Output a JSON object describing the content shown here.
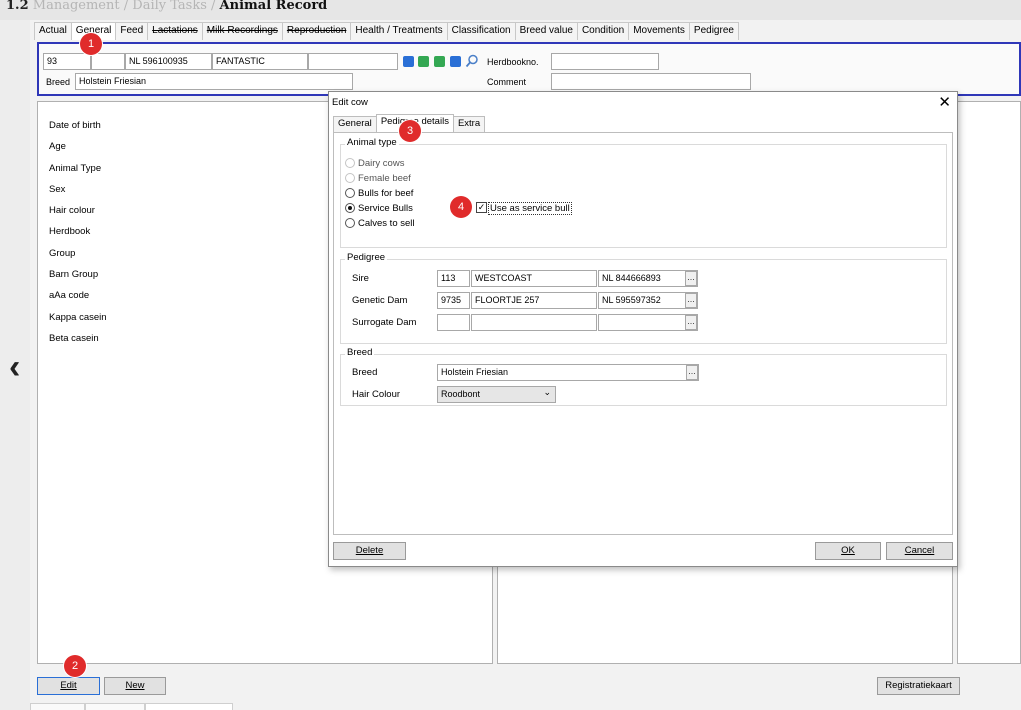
{
  "breadcrumb": {
    "number": "1.2",
    "path1": "Management",
    "sep": "/",
    "path2": "Daily Tasks",
    "current": "Animal Record"
  },
  "tabs": [
    {
      "label": "Actual",
      "strike": false
    },
    {
      "label": "General",
      "strike": false,
      "active": true
    },
    {
      "label": "Feed",
      "strike": false
    },
    {
      "label": "Lactations",
      "strike": true
    },
    {
      "label": "Milk Recordings",
      "strike": true
    },
    {
      "label": "Reproduction",
      "strike": true
    },
    {
      "label": "Health / Treatments",
      "strike": false
    },
    {
      "label": "Classification",
      "strike": false
    },
    {
      "label": "Breed value",
      "strike": false
    },
    {
      "label": "Condition",
      "strike": false
    },
    {
      "label": "Movements",
      "strike": false
    },
    {
      "label": "Pedigree",
      "strike": false
    }
  ],
  "header": {
    "animal_no": "93",
    "field2": "",
    "life_no": "NL 596100935",
    "name": "FANTASTIC",
    "field5": "",
    "herdbook_label": "Herdbookno.",
    "herdbook_value": "",
    "breed_label": "Breed",
    "breed_value": "Holstein Friesian",
    "comment_label": "Comment",
    "comment_value": ""
  },
  "nav_colors": {
    "first": "#2a6fd6",
    "prev": "#34a853",
    "next": "#34a853",
    "last": "#2a6fd6"
  },
  "left_fields": [
    "Date of birth",
    "Age",
    "Animal Type",
    "Sex",
    "Hair colour",
    "Herdbook",
    "Group",
    "Barn Group",
    "aAa code",
    "Kappa casein",
    "Beta casein"
  ],
  "badges": {
    "b1": "1",
    "b2": "2",
    "b3": "3",
    "b4": "4"
  },
  "bottom_buttons": {
    "edit": "Edit",
    "new": "New",
    "reg": "Registratiekaart"
  },
  "dialog": {
    "title": "Edit cow",
    "close": "✕",
    "tabs": [
      "General",
      "Pedigree details",
      "Extra"
    ],
    "animal_type": {
      "title": "Animal type",
      "options": [
        {
          "label": "Dairy cows",
          "enabled": false,
          "checked": false
        },
        {
          "label": "Female beef",
          "enabled": false,
          "checked": false
        },
        {
          "label": "Bulls for beef",
          "enabled": true,
          "checked": false
        },
        {
          "label": "Service Bulls",
          "enabled": true,
          "checked": true
        },
        {
          "label": "Calves to sell",
          "enabled": true,
          "checked": false
        }
      ],
      "service_bull_label": "Use as service bull",
      "service_bull_checked": true
    },
    "pedigree": {
      "title": "Pedigree",
      "rows": [
        {
          "label": "Sire",
          "no": "113",
          "name": "WESTCOAST",
          "life": "NL 844666893"
        },
        {
          "label": "Genetic Dam",
          "no": "9735",
          "name": "FLOORTJE 257",
          "life": "NL 595597352"
        },
        {
          "label": "Surrogate Dam",
          "no": "",
          "name": "",
          "life": ""
        }
      ]
    },
    "breed": {
      "title": "Breed",
      "breed_label": "Breed",
      "breed_value": "Holstein Friesian",
      "hair_label": "Hair Colour",
      "hair_value": "Roodbont"
    },
    "buttons": {
      "delete": "Delete",
      "ok": "OK",
      "cancel": "Cancel"
    }
  }
}
